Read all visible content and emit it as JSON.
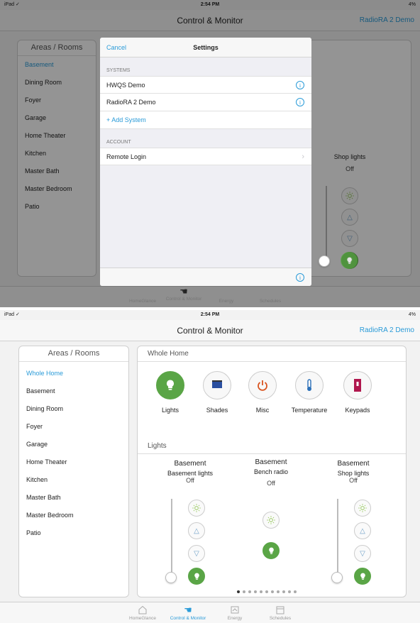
{
  "status": {
    "carrier": "iPad ✓",
    "time": "2:54 PM",
    "battery": "4%"
  },
  "nav": {
    "title": "Control & Monitor",
    "system": "RadioRA 2 Demo"
  },
  "rooms_header": "Areas / Rooms",
  "rooms_top": [
    "Basement",
    "Dining Room",
    "Foyer",
    "Garage",
    "Home Theater",
    "Kitchen",
    "Master Bath",
    "Master Bedroom",
    "Patio"
  ],
  "rooms_bottom": [
    "Whole Home",
    "Basement",
    "Dining Room",
    "Foyer",
    "Garage",
    "Home Theater",
    "Kitchen",
    "Master Bath",
    "Master Bedroom",
    "Patio"
  ],
  "settings": {
    "cancel": "Cancel",
    "title": "Settings",
    "systems_header": "SYSTEMS",
    "systems": [
      "HWQS Demo",
      "RadioRA 2 Demo"
    ],
    "add_system": "+ Add System",
    "account_header": "ACCOUNT",
    "remote_login": "Remote Login"
  },
  "bg_shop": {
    "name": "Shop lights",
    "status": "Off"
  },
  "main": {
    "section_title": "Whole Home",
    "categories": [
      "Lights",
      "Shades",
      "Misc",
      "Temperature",
      "Keypads"
    ],
    "lights_title": "Lights",
    "loads": [
      {
        "area": "Basement",
        "name": "Basement lights",
        "status": "Off"
      },
      {
        "area": "Basement",
        "name": "Bench radio",
        "status": "Off"
      },
      {
        "area": "Basement",
        "name": "Shop lights",
        "status": "Off"
      }
    ]
  },
  "tabs": [
    "HomeGlance",
    "Control & Monitor",
    "Energy",
    "Schedules"
  ],
  "colors": {
    "accent": "#2a9bd8",
    "green": "#5aa546",
    "power": "#d9531e",
    "temp": "#2a6fb8",
    "keypad": "#b0174e"
  }
}
